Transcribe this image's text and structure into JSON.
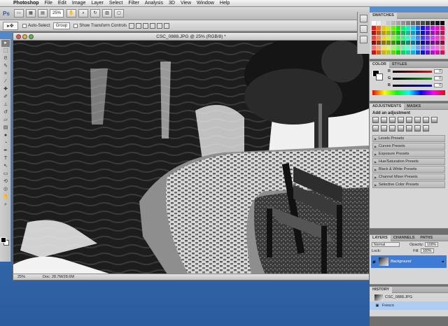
{
  "menubar": {
    "app_name": "Photoshop",
    "items": [
      "File",
      "Edit",
      "Image",
      "Layer",
      "Select",
      "Filter",
      "Analysis",
      "3D",
      "View",
      "Window",
      "Help"
    ]
  },
  "appbar": {
    "logo": "Ps",
    "zoom": "25%"
  },
  "optionsbar": {
    "tool_symbol": "▸✥",
    "auto_select_label": "Auto-Select:",
    "auto_select_value": "Group",
    "transform_label": "Show Transform Controls"
  },
  "document": {
    "title": "CSC_0888.JPG @ 25% (RGB/8) *",
    "zoom": "25%",
    "doc_size": "Doc: 28.7M/28.6M"
  },
  "panels": {
    "swatches_tab": "SWATCHES",
    "color_tab": "COLOR",
    "styles_tab": "STYLES",
    "color_values": {
      "r": "0",
      "g": "0",
      "b": "0"
    },
    "adjustments_tab": "ADJUSTMENTS",
    "masks_tab": "MASKS",
    "add_adjustment": "Add an adjustment",
    "presets": [
      "Levels Presets",
      "Curves Presets",
      "Exposure Presets",
      "Hue/Saturation Presets",
      "Black & White Presets",
      "Channel Mixer Presets",
      "Selective Color Presets"
    ],
    "layers_tab": "LAYERS",
    "channels_tab": "CHANNELS",
    "paths_tab": "PATHS",
    "blend_mode": "Normal",
    "opacity_label": "Opacity:",
    "opacity_value": "100%",
    "lock_label": "Lock:",
    "fill_label": "Fill:",
    "fill_value": "100%",
    "layer_name": "Background",
    "history_tab": "HISTORY",
    "history_items": [
      "CSC_0888.JPG",
      "Fresco"
    ]
  }
}
